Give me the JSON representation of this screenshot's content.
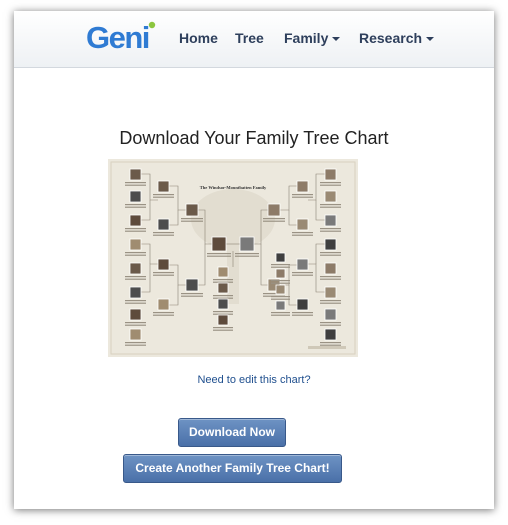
{
  "header": {
    "logo_text": "Geni",
    "nav": [
      {
        "label": "Home"
      },
      {
        "label": "Tree"
      },
      {
        "label": "Family"
      },
      {
        "label": "Research"
      }
    ]
  },
  "main": {
    "title": "Download Your Family Tree Chart",
    "chart_preview": {
      "heading": "The Windsor-Mountbatten Family"
    },
    "edit_link": "Need to edit this chart?",
    "download_button": "Download Now",
    "create_button": "Create Another Family Tree Chart!"
  },
  "colors": {
    "nav_text": "#2e3f5c",
    "logo_blue": "#2f7bd3",
    "logo_green": "#8cc63f",
    "button": "#5a7fb6",
    "link": "#1f4f8e"
  }
}
